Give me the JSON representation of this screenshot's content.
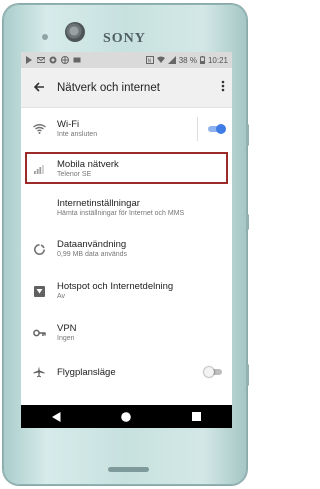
{
  "brand": "SONY",
  "status": {
    "battery_percent": "38 %",
    "time": "10:21"
  },
  "appbar": {
    "title": "Nätverk och internet",
    "back_icon": "arrow-left-icon",
    "menu_icon": "more-vert-icon"
  },
  "settings": [
    {
      "id": "wifi",
      "title": "Wi-Fi",
      "subtitle": "Inte ansluten",
      "icon": "wifi-icon",
      "toggle": "on"
    },
    {
      "id": "mobile",
      "title": "Mobila nätverk",
      "subtitle": "Telenor SE",
      "icon": "signal-icon",
      "highlighted": true
    },
    {
      "id": "internet",
      "title": "Internetinställningar",
      "subtitle": "Hämta inställningar för Internet och MMS",
      "icon": ""
    },
    {
      "id": "data",
      "title": "Dataanvändning",
      "subtitle": "0,99 MB data används",
      "icon": "data-usage-icon"
    },
    {
      "id": "hotspot",
      "title": "Hotspot och Internetdelning",
      "subtitle": "Av",
      "icon": "hotspot-icon"
    },
    {
      "id": "vpn",
      "title": "VPN",
      "subtitle": "Ingen",
      "icon": "vpn-key-icon"
    },
    {
      "id": "airplane",
      "title": "Flygplansläge",
      "subtitle": "",
      "icon": "airplane-icon",
      "toggle": "off"
    }
  ],
  "colors": {
    "toggle_on": "#3f7de6",
    "highlight_border": "#9b2a2a",
    "phone_body": "#c7e1df"
  }
}
